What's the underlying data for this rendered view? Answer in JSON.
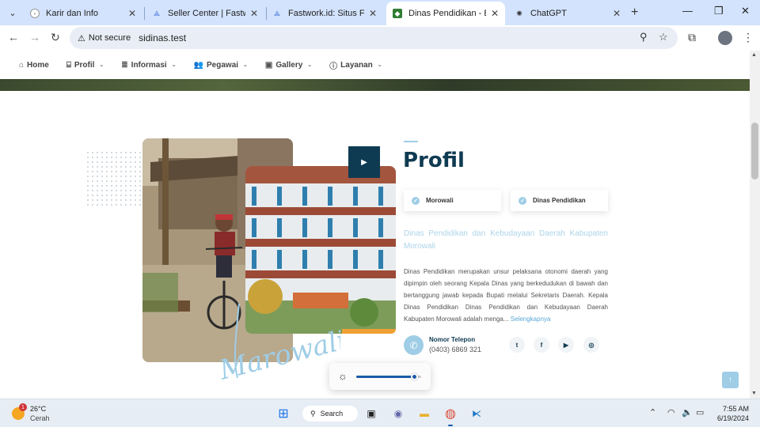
{
  "browser": {
    "tabs": [
      {
        "title": "Karir dan Info",
        "active": false
      },
      {
        "title": "Seller Center | Fastwork.id",
        "active": false
      },
      {
        "title": "Fastwork.id: Situs Freelanc",
        "active": false
      },
      {
        "title": "Dinas Pendidikan - Beranda",
        "active": true
      },
      {
        "title": "ChatGPT",
        "active": false
      }
    ],
    "security_label": "Not secure",
    "url": "sidinas.test"
  },
  "site_nav": {
    "items": [
      {
        "label": "Home",
        "icon": "home-icon",
        "has_menu": false
      },
      {
        "label": "Profil",
        "icon": "bank-icon",
        "has_menu": true
      },
      {
        "label": "Informasi",
        "icon": "database-icon",
        "has_menu": true
      },
      {
        "label": "Pegawai",
        "icon": "users-icon",
        "has_menu": true
      },
      {
        "label": "Gallery",
        "icon": "images-icon",
        "has_menu": true
      },
      {
        "label": "Layanan",
        "icon": "help-icon",
        "has_menu": true
      }
    ]
  },
  "profile": {
    "signature_text": "Marowali",
    "title": "Profil",
    "cards": [
      "Morowali",
      "Dinas Pendidikan"
    ],
    "lead": "Dinas Pendidikan dan Kebudayaan Daerah Kabupaten Morowali",
    "body": "Dinas Pendidikan merupakan unsur pelaksana otonomi daerah yang dipimpin oleh seorang Kepala Dinas yang berkedudukan di bawah dan bertanggung jawab kepada Bupati melalui Sekretaris Daerah. Kepala Dinas Pendidikan Dinas Pendidikan dan Kebudayaan Daerah Kabupaten Morowali adalah menga...",
    "read_more": "Selengkapnya",
    "phone_label": "Nomor Telepon",
    "phone_number": "(0403) 6869 321",
    "social": [
      "twitter-icon",
      "facebook-icon",
      "youtube-icon",
      "instagram-icon"
    ]
  },
  "brightness_level": 0.9,
  "taskbar": {
    "weather_badge": "1",
    "temperature": "26°C",
    "condition": "Cerah",
    "search_label": "Search",
    "time": "7:55 AM",
    "date": "6/19/2024"
  },
  "colors": {
    "primary": "#0f3b52",
    "accent": "#9fcde6",
    "tabstrip": "#d3e3fd"
  }
}
